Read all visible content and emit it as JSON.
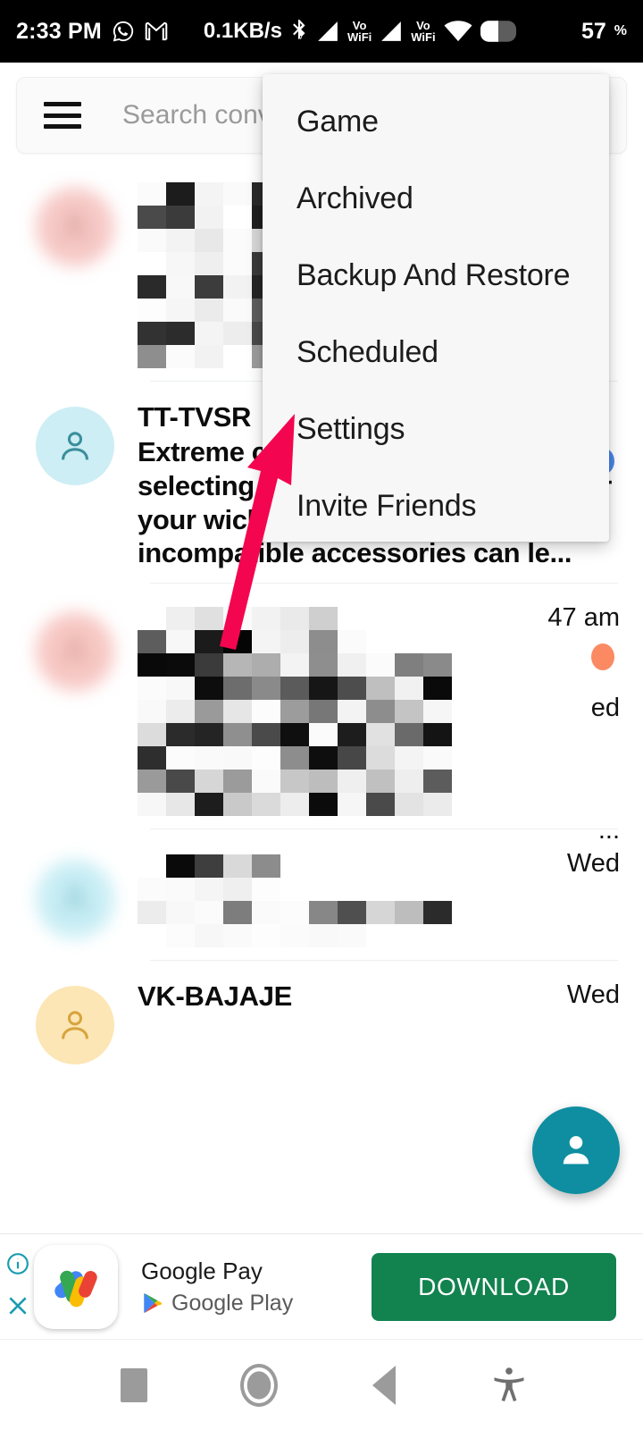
{
  "statusbar": {
    "time": "2:33 PM",
    "whatsapp_icon": "whatsapp-icon",
    "gmail_icon": "gmail-icon",
    "data_rate": "0.1KB/s",
    "bluetooth_icon": "bluetooth-icon",
    "signal1_icon": "signal-bars-icon",
    "volte1_top": "Vo",
    "volte1_bottom": "WiFi",
    "signal2_icon": "signal-bars-icon",
    "volte2_top": "Vo",
    "volte2_bottom": "WiFi",
    "wifi_icon": "wifi-icon",
    "battery_icon": "battery-icon",
    "battery_level": "57",
    "battery_unit": "%"
  },
  "search": {
    "menu_icon": "hamburger-menu-icon",
    "placeholder": "Search conv"
  },
  "menu": {
    "items": [
      {
        "label": "Game"
      },
      {
        "label": "Archived"
      },
      {
        "label": "Backup And Restore"
      },
      {
        "label": "Scheduled"
      },
      {
        "label": "Settings"
      },
      {
        "label": "Invite Friends"
      }
    ]
  },
  "annotation": {
    "type": "arrow",
    "points_to": "Settings",
    "color": "#F4054F"
  },
  "conversations": [
    {
      "id": "row-1",
      "redacted": true,
      "avatar_color": "#f6c9c6",
      "avatar_icon": "person-icon",
      "title": "",
      "snippet": "",
      "time": "",
      "badge_color": ""
    },
    {
      "id": "row-2",
      "redacted": false,
      "avatar_color": "#cdeef4",
      "avatar_icon": "person-icon",
      "title": "TT-TVSR",
      "snippet": "Extreme caution is advised when selecting & installing accessories for your wicked TVS Raider. Unsafe & incompatible accessories can le...",
      "time": "",
      "badge_color": "#4a86e8"
    },
    {
      "id": "row-3",
      "redacted": true,
      "avatar_color": "#f7c8c4",
      "avatar_icon": "person-icon",
      "title": "",
      "snippet": "",
      "time": "47 am",
      "time_fragment2": "ed",
      "time_fragment3": "...",
      "badge_color": "#fb8a63"
    },
    {
      "id": "row-4",
      "redacted": true,
      "avatar_color": "#c9eef5",
      "avatar_icon": "person-icon",
      "title": "",
      "snippet": "",
      "time": "Wed",
      "badge_color": ""
    },
    {
      "id": "row-5",
      "redacted": false,
      "avatar_color": "#fde6b5",
      "avatar_icon": "person-icon",
      "title": "VK-BAJAJE",
      "snippet": "",
      "time": "Wed",
      "badge_color": ""
    }
  ],
  "fab": {
    "icon": "new-contact-icon",
    "color": "#0E8EA0"
  },
  "ad": {
    "info_icon": "info-icon",
    "close_icon": "close-icon",
    "app_icon": "google-pay-icon",
    "title": "Google Pay",
    "store_icon": "google-play-icon",
    "store": "Google Play",
    "cta_label": "DOWNLOAD",
    "cta_color": "#12824F"
  },
  "navbar": {
    "items": [
      {
        "name": "recents-button",
        "icon": "square-icon"
      },
      {
        "name": "home-button",
        "icon": "circle-icon"
      },
      {
        "name": "back-button",
        "icon": "triangle-left-icon"
      },
      {
        "name": "accessibility-button",
        "icon": "accessibility-icon"
      }
    ]
  }
}
